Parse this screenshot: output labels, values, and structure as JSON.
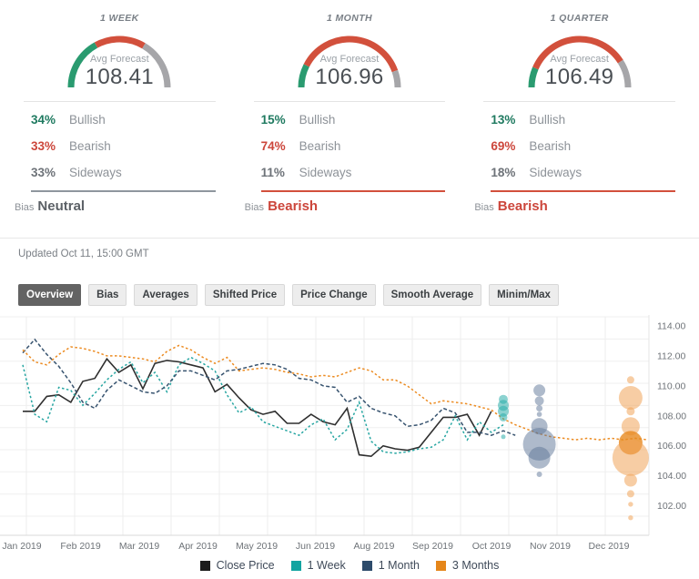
{
  "panels": [
    {
      "title": "1 WEEK",
      "avg_label": "Avg Forecast",
      "avg_value": "108.41",
      "gauge": {
        "bullish_pct": 34,
        "bearish_pct": 33,
        "sideways_pct": 33,
        "colors": {
          "bullish": "#2a9b70",
          "bearish": "#d2503c",
          "sideways": "#a6a6a9"
        }
      },
      "rows": [
        {
          "pct": "34%",
          "label": "Bullish",
          "pct_color": "#1f7a60"
        },
        {
          "pct": "33%",
          "label": "Bearish",
          "pct_color": "#cc463b"
        },
        {
          "pct": "33%",
          "label": "Sideways",
          "pct_color": "#6d7278"
        }
      ],
      "bias_label": "Bias",
      "bias_value": "Neutral",
      "bias_color": "#5c6167",
      "rule_color": "#8f969e"
    },
    {
      "title": "1 MONTH",
      "avg_label": "Avg Forecast",
      "avg_value": "106.96",
      "gauge": {
        "bullish_pct": 15,
        "bearish_pct": 74,
        "sideways_pct": 11,
        "colors": {
          "bullish": "#2a9b70",
          "bearish": "#d2503c",
          "sideways": "#a6a6a9"
        }
      },
      "rows": [
        {
          "pct": "15%",
          "label": "Bullish",
          "pct_color": "#1f7a60"
        },
        {
          "pct": "74%",
          "label": "Bearish",
          "pct_color": "#cc463b"
        },
        {
          "pct": "11%",
          "label": "Sideways",
          "pct_color": "#6d7278"
        }
      ],
      "bias_label": "Bias",
      "bias_value": "Bearish",
      "bias_color": "#cc463b",
      "rule_color": "#d2503c"
    },
    {
      "title": "1 QUARTER",
      "avg_label": "Avg Forecast",
      "avg_value": "106.49",
      "gauge": {
        "bullish_pct": 13,
        "bearish_pct": 69,
        "sideways_pct": 18,
        "colors": {
          "bullish": "#2a9b70",
          "bearish": "#d2503c",
          "sideways": "#a6a6a9"
        }
      },
      "rows": [
        {
          "pct": "13%",
          "label": "Bullish",
          "pct_color": "#1f7a60"
        },
        {
          "pct": "69%",
          "label": "Bearish",
          "pct_color": "#cc463b"
        },
        {
          "pct": "18%",
          "label": "Sideways",
          "pct_color": "#6d7278"
        }
      ],
      "bias_label": "Bias",
      "bias_value": "Bearish",
      "bias_color": "#cc463b",
      "rule_color": "#d2503c"
    }
  ],
  "updated_text": "Updated Oct 11, 15:00 GMT",
  "tabs": [
    {
      "label": "Overview",
      "active": true
    },
    {
      "label": "Bias",
      "active": false
    },
    {
      "label": "Averages",
      "active": false
    },
    {
      "label": "Shifted Price",
      "active": false
    },
    {
      "label": "Price Change",
      "active": false
    },
    {
      "label": "Smooth Average",
      "active": false
    },
    {
      "label": "Minim/Max",
      "active": false
    }
  ],
  "chart_data": {
    "type": "line",
    "title": "",
    "xlabel": "",
    "ylabel": "",
    "x_tick_labels": [
      "Jan 2019",
      "Feb 2019",
      "Mar 2019",
      "Apr 2019",
      "May 2019",
      "Jun 2019",
      "Aug 2019",
      "Sep 2019",
      "Oct 2019",
      "Nov 2019",
      "Dec 2019"
    ],
    "y_ticks": [
      114,
      112,
      110,
      108,
      106,
      104,
      102
    ],
    "ylim": [
      100.0,
      114.7
    ],
    "grid": true,
    "legend_position": "bottom",
    "series": [
      {
        "name": "Close Price",
        "color": "#2f2f2f",
        "style": "solid",
        "weekly_values": [
          108.3,
          108.3,
          109.3,
          109.4,
          108.9,
          110.3,
          110.5,
          111.8,
          110.9,
          111.4,
          109.8,
          111.5,
          111.7,
          111.6,
          111.4,
          111.2,
          109.6,
          110.1,
          109.2,
          108.4,
          108.1,
          108.3,
          107.5,
          107.5,
          108.1,
          107.6,
          107.4,
          108.5,
          105.4,
          105.3,
          106.0,
          105.8,
          105.7,
          105.9,
          106.9,
          107.9,
          107.9,
          108.1,
          106.7,
          108.3
        ]
      },
      {
        "name": "1 Week",
        "color": "#27a6a2",
        "style": "dashed",
        "weekly_values": [
          111.4,
          108.1,
          107.6,
          109.9,
          109.7,
          108.7,
          109.5,
          110.4,
          111.1,
          111.6,
          110.2,
          110.9,
          109.6,
          111.4,
          111.9,
          111.5,
          111.0,
          109.4,
          108.2,
          108.6,
          107.6,
          107.3,
          107.0,
          106.7,
          107.4,
          107.8,
          106.4,
          107.1,
          108.9,
          106.3,
          105.6,
          105.5,
          105.6,
          105.8,
          105.9,
          106.4,
          108.0,
          106.4,
          107.6,
          106.9,
          107.4
        ]
      },
      {
        "name": "1 Month",
        "color": "#37536f",
        "style": "dashed",
        "weekly_values": [
          112.2,
          113.1,
          112.1,
          111.3,
          110.2,
          108.9,
          108.5,
          109.7,
          110.4,
          110.0,
          109.6,
          109.5,
          110.0,
          111.0,
          111.0,
          110.7,
          110.4,
          111.0,
          111.1,
          111.3,
          111.5,
          111.4,
          111.1,
          110.5,
          110.4,
          110.0,
          109.9,
          108.9,
          109.3,
          108.5,
          108.2,
          108.0,
          107.3,
          107.4,
          107.7,
          108.5,
          108.2,
          106.9,
          106.9,
          106.7,
          107.0,
          106.7
        ]
      },
      {
        "name": "3 Months",
        "color": "#ec8b21",
        "style": "dashed",
        "weekly_values": [
          112.4,
          111.6,
          111.4,
          112.1,
          112.6,
          112.5,
          112.3,
          112.0,
          112.0,
          111.9,
          111.8,
          111.6,
          112.3,
          112.7,
          112.4,
          111.9,
          111.5,
          111.9,
          111.0,
          111.1,
          111.2,
          111.1,
          110.9,
          110.8,
          110.6,
          110.7,
          110.6,
          110.9,
          111.2,
          111.0,
          110.4,
          110.4,
          110.0,
          109.4,
          108.8,
          109.0,
          108.9,
          108.8,
          108.6,
          108.4,
          107.8,
          107.4,
          107.1,
          106.8,
          106.6,
          106.5,
          106.4,
          106.5,
          106.4,
          106.5,
          106.4,
          106.5,
          106.4
        ]
      }
    ],
    "forecast_bubbles": [
      {
        "series": "1 Week",
        "week_x": 40,
        "color": "#2cada9",
        "opacity": 0.55,
        "points": [
          {
            "value": 109.1,
            "r": 5
          },
          {
            "value": 108.7,
            "r": 6
          },
          {
            "value": 108.3,
            "r": 6
          },
          {
            "value": 107.9,
            "r": 4.5
          },
          {
            "value": 106.6,
            "r": 2.5
          }
        ]
      },
      {
        "series": "1 Month",
        "week_x": 43,
        "color": "#5d7698",
        "opacity": 0.5,
        "points": [
          {
            "value": 109.7,
            "r": 6.5
          },
          {
            "value": 109.0,
            "r": 5
          },
          {
            "value": 108.5,
            "r": 3.5
          },
          {
            "value": 108.1,
            "r": 2.8
          },
          {
            "value": 107.3,
            "r": 9
          },
          {
            "value": 106.1,
            "r": 18
          },
          {
            "value": 105.2,
            "r": 12
          },
          {
            "value": 104.1,
            "r": 3
          }
        ]
      },
      {
        "series": "3 Months",
        "week_x": 50.6,
        "color": "#f0a45a",
        "opacity": 0.55,
        "points": [
          {
            "value": 110.4,
            "r": 4
          },
          {
            "value": 109.2,
            "r": 13
          },
          {
            "value": 108.3,
            "r": 4.5
          },
          {
            "value": 107.3,
            "r": 10
          },
          {
            "value": 106.2,
            "r": 13,
            "color": "#e78a1f",
            "opacity": 0.8
          },
          {
            "value": 105.2,
            "r": 20
          },
          {
            "value": 103.7,
            "r": 7
          },
          {
            "value": 102.8,
            "r": 4
          },
          {
            "value": 102.1,
            "r": 2.7
          },
          {
            "value": 101.2,
            "r": 2.7
          }
        ]
      }
    ],
    "legend": [
      {
        "label": "Close Price",
        "color": "#1c1c1c"
      },
      {
        "label": "1 Week",
        "color": "#12a4a1"
      },
      {
        "label": "1 Month",
        "color": "#2d4b6b"
      },
      {
        "label": "3 Months",
        "color": "#e5861a"
      }
    ]
  }
}
